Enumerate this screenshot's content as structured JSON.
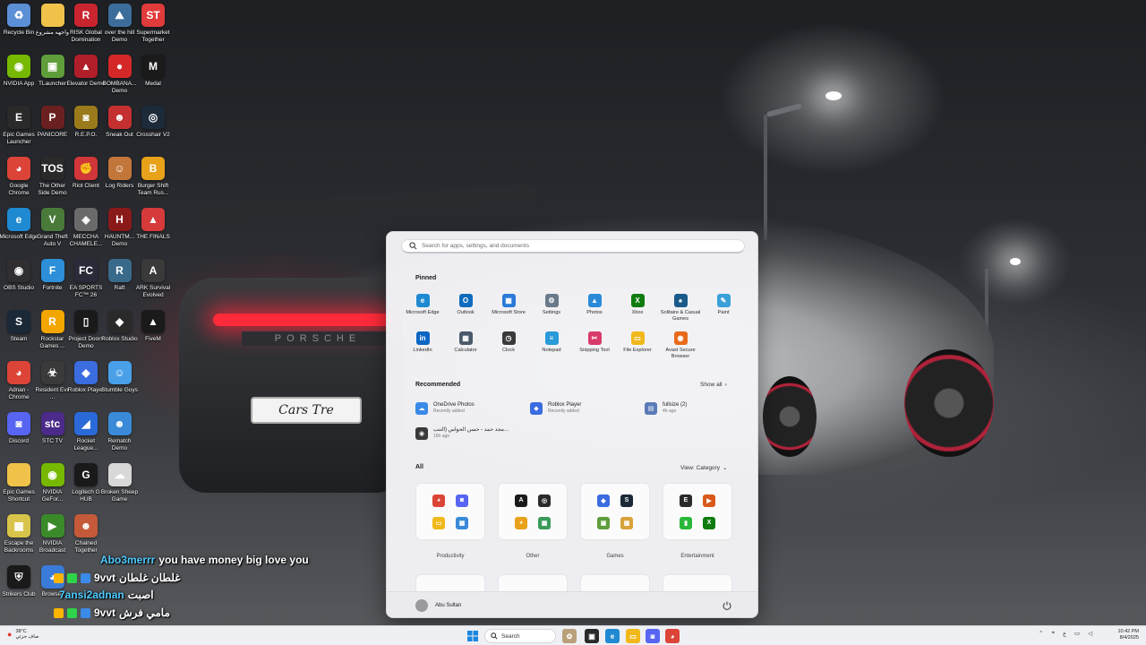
{
  "desktop": {
    "icons": [
      {
        "label": "Recycle Bin",
        "icon": "recycle-bin-icon",
        "color": "#5b8fd6",
        "glyph": "♻"
      },
      {
        "label": "واجهه مشروع",
        "icon": "folder-icon",
        "color": "#f0c24a",
        "glyph": ""
      },
      {
        "label": "RISK Global Domination",
        "icon": "risk-icon",
        "color": "#c9252f",
        "glyph": "R"
      },
      {
        "label": "over the hill Demo",
        "icon": "over-the-hill-icon",
        "color": "#3c6d9a",
        "glyph": "⛰"
      },
      {
        "label": "Supermarket Together",
        "icon": "supermarket-icon",
        "color": "#e03b3b",
        "glyph": "ST"
      },
      {
        "label": "NVIDIA App",
        "icon": "nvidia-icon",
        "color": "#76b900",
        "glyph": "◉"
      },
      {
        "label": "TLauncher",
        "icon": "tlauncher-icon",
        "color": "#5f9e3a",
        "glyph": "▣"
      },
      {
        "label": "Elevator Demo",
        "icon": "elevator-icon",
        "color": "#b01e2a",
        "glyph": "▲"
      },
      {
        "label": "BOMBANA... Demo",
        "icon": "bombana-icon",
        "color": "#d42828",
        "glyph": "●"
      },
      {
        "label": "Medal",
        "icon": "medal-icon",
        "color": "#1a1a1a",
        "glyph": "M"
      },
      {
        "label": "Epic Games Launcher",
        "icon": "epic-games-icon",
        "color": "#2a2a2a",
        "glyph": "E"
      },
      {
        "label": "PANICORE",
        "icon": "panicore-icon",
        "color": "#6b2020",
        "glyph": "P"
      },
      {
        "label": "R.E.P.O.",
        "icon": "repo-icon",
        "color": "#9a7a1a",
        "glyph": "◙"
      },
      {
        "label": "Sneak Out",
        "icon": "sneak-out-icon",
        "color": "#c43030",
        "glyph": "☻"
      },
      {
        "label": "Crosshair V2",
        "icon": "crosshair-icon",
        "color": "#1c2a3a",
        "glyph": "◎"
      },
      {
        "label": "Google Chrome",
        "icon": "chrome-icon",
        "color": "#db4437",
        "glyph": "◕"
      },
      {
        "label": "The Other Side Demo",
        "icon": "other-side-icon",
        "color": "#2a2a2a",
        "glyph": "TOS"
      },
      {
        "label": "Riot Client",
        "icon": "riot-icon",
        "color": "#d13639",
        "glyph": "✊"
      },
      {
        "label": "Log Riders",
        "icon": "log-riders-icon",
        "color": "#c2763a",
        "glyph": "☺"
      },
      {
        "label": "Burger Shift Team Rus...",
        "icon": "burger-shift-icon",
        "color": "#e8a21a",
        "glyph": "B"
      },
      {
        "label": "Microsoft Edge",
        "icon": "edge-icon",
        "color": "#1f8ad2",
        "glyph": "e"
      },
      {
        "label": "Grand Theft Auto V",
        "icon": "gta-icon",
        "color": "#4a7a3a",
        "glyph": "V"
      },
      {
        "label": "MECCHA CHAMELE...",
        "icon": "meccha-icon",
        "color": "#6a6a6a",
        "glyph": "◈"
      },
      {
        "label": "HAUNTM... Demo",
        "icon": "hauntm-icon",
        "color": "#8a1a1a",
        "glyph": "H"
      },
      {
        "label": "THE FINALS",
        "icon": "the-finals-icon",
        "color": "#d63a3a",
        "glyph": "▲"
      },
      {
        "label": "OBS Studio",
        "icon": "obs-icon",
        "color": "#302e31",
        "glyph": "◉"
      },
      {
        "label": "Fortnite",
        "icon": "fortnite-icon",
        "color": "#2c8fd8",
        "glyph": "F"
      },
      {
        "label": "EA SPORTS FC™ 26",
        "icon": "ea-fc-icon",
        "color": "#2a2a3a",
        "glyph": "FC"
      },
      {
        "label": "Raft",
        "icon": "raft-icon",
        "color": "#3a6a8a",
        "glyph": "R"
      },
      {
        "label": "ARK Survival Evolved",
        "icon": "ark-icon",
        "color": "#3a3a3a",
        "glyph": "A"
      },
      {
        "label": "Steam",
        "icon": "steam-icon",
        "color": "#1b2838",
        "glyph": "S"
      },
      {
        "label": "Rockstar Games ...",
        "icon": "rockstar-icon",
        "color": "#f3a600",
        "glyph": "R"
      },
      {
        "label": "Project Doors Demo",
        "icon": "project-doors-icon",
        "color": "#1a1a1a",
        "glyph": "▯"
      },
      {
        "label": "Roblox Studio",
        "icon": "roblox-studio-icon",
        "color": "#2a2a2a",
        "glyph": "◆"
      },
      {
        "label": "FiveM",
        "icon": "fivem-icon",
        "color": "#1a1a1a",
        "glyph": "▲"
      },
      {
        "label": "Adnan - Chrome",
        "icon": "chrome-profile-icon",
        "color": "#db4437",
        "glyph": "◕"
      },
      {
        "label": "Resident Evil ...",
        "icon": "resident-evil-icon",
        "color": "#3a3a3a",
        "glyph": "☣"
      },
      {
        "label": "Roblox Player",
        "icon": "roblox-player-icon",
        "color": "#3b6ce0",
        "glyph": "◆"
      },
      {
        "label": "Stumble Guys",
        "icon": "stumble-guys-icon",
        "color": "#4aa0e8",
        "glyph": "☺"
      },
      {
        "label": "",
        "icon": "blank-icon",
        "color": "transparent",
        "glyph": ""
      },
      {
        "label": "Discord",
        "icon": "discord-icon",
        "color": "#5865f2",
        "glyph": "◙"
      },
      {
        "label": "STC TV",
        "icon": "stc-tv-icon",
        "color": "#4b2a8a",
        "glyph": "stc"
      },
      {
        "label": "Rocket League...",
        "icon": "rocket-league-icon",
        "color": "#2a6ad8",
        "glyph": "◢"
      },
      {
        "label": "Rematch Demo",
        "icon": "rematch-icon",
        "color": "#3a8ad8",
        "glyph": "☻"
      },
      {
        "label": "",
        "icon": "blank-icon",
        "color": "transparent",
        "glyph": ""
      },
      {
        "label": "Epic Games Shortcut",
        "icon": "epic-shortcut-icon",
        "color": "#f0c24a",
        "glyph": ""
      },
      {
        "label": "NVIDIA GeFor...",
        "icon": "geforce-icon",
        "color": "#76b900",
        "glyph": "◉"
      },
      {
        "label": "Logitech G HUB",
        "icon": "ghub-icon",
        "color": "#1a1a1a",
        "glyph": "G"
      },
      {
        "label": "Broken Sheep Game",
        "icon": "sheep-game-icon",
        "color": "#d8d8d8",
        "glyph": "☁"
      },
      {
        "label": "",
        "icon": "blank-icon",
        "color": "transparent",
        "glyph": ""
      },
      {
        "label": "Escape the Backrooms",
        "icon": "backrooms-icon",
        "color": "#d8c44a",
        "glyph": "▦"
      },
      {
        "label": "NVIDIA Broadcast",
        "icon": "nvidia-broadcast-icon",
        "color": "#3a8a2a",
        "glyph": "▶"
      },
      {
        "label": "Chained Together",
        "icon": "chained-together-icon",
        "color": "#c45a3a",
        "glyph": "☻"
      },
      {
        "label": "",
        "icon": "blank-icon",
        "color": "transparent",
        "glyph": ""
      },
      {
        "label": "",
        "icon": "blank-icon",
        "color": "transparent",
        "glyph": ""
      },
      {
        "label": "Strikers Club",
        "icon": "strikers-club-icon",
        "color": "#1a1a1a",
        "glyph": "⛨"
      },
      {
        "label": "Browser",
        "icon": "browser-icon",
        "color": "#3a7ad8",
        "glyph": "◕"
      }
    ]
  },
  "start_menu": {
    "search_placeholder": "Search for apps, settings, and documents",
    "pinned_title": "Pinned",
    "pinned": [
      {
        "label": "Microsoft Edge",
        "icon": "edge-icon",
        "color": "#1f8ad2",
        "glyph": "e"
      },
      {
        "label": "Outlook",
        "icon": "outlook-icon",
        "color": "#0f6cbd",
        "glyph": "O"
      },
      {
        "label": "Microsoft Store",
        "icon": "store-icon",
        "color": "#2a7ad8",
        "glyph": "▦"
      },
      {
        "label": "Settings",
        "icon": "settings-icon",
        "color": "#6a7a8a",
        "glyph": "⚙"
      },
      {
        "label": "Photos",
        "icon": "photos-icon",
        "color": "#2a8ad8",
        "glyph": "▲"
      },
      {
        "label": "Xbox",
        "icon": "xbox-icon",
        "color": "#107c10",
        "glyph": "X"
      },
      {
        "label": "Solitaire & Casual Games",
        "icon": "solitaire-icon",
        "color": "#1a5a8a",
        "glyph": "♠"
      },
      {
        "label": "Paint",
        "icon": "paint-icon",
        "color": "#3aa0d8",
        "glyph": "✎"
      },
      {
        "label": "LinkedIn",
        "icon": "linkedin-icon",
        "color": "#0a66c2",
        "glyph": "in"
      },
      {
        "label": "Calculator",
        "icon": "calculator-icon",
        "color": "#4a5a6a",
        "glyph": "▦"
      },
      {
        "label": "Clock",
        "icon": "clock-icon",
        "color": "#3a3a3a",
        "glyph": "◷"
      },
      {
        "label": "Notepad",
        "icon": "notepad-icon",
        "color": "#2a9ad8",
        "glyph": "≡"
      },
      {
        "label": "Snipping Tool",
        "icon": "snipping-tool-icon",
        "color": "#d83a6a",
        "glyph": "✂"
      },
      {
        "label": "File Explorer",
        "icon": "file-explorer-icon",
        "color": "#f0b81a",
        "glyph": "▭"
      },
      {
        "label": "Avast Secure Browser",
        "icon": "avast-browser-icon",
        "color": "#e86a1a",
        "glyph": "◉"
      }
    ],
    "recommended_title": "Recommended",
    "show_all": "Show all",
    "recommended": [
      {
        "title": "OneDrive Photos",
        "sub": "Recently added",
        "icon": "onedrive-icon",
        "color": "#3a8ae8",
        "glyph": "☁"
      },
      {
        "title": "Roblox Player",
        "sub": "Recently added",
        "icon": "roblox-player-icon",
        "color": "#3b6ce0",
        "glyph": "◆"
      },
      {
        "title": "fullsize (2)",
        "sub": "4h ago",
        "icon": "file-icon",
        "color": "#5a7ab8",
        "glyph": "▤"
      },
      {
        "title": "مجد حمد - حسن الحواس (التنب...",
        "sub": "16h ago",
        "icon": "media-file-icon",
        "color": "#3a3a3a",
        "glyph": "◉"
      }
    ],
    "all_title": "All",
    "view_label": "View: Category",
    "categories": [
      {
        "name": "Productivity",
        "apps": [
          {
            "icon": "chrome-icon",
            "color": "#db4437",
            "glyph": "◕"
          },
          {
            "icon": "discord-icon",
            "color": "#5865f2",
            "glyph": "◙"
          },
          {
            "icon": "folder-icon",
            "color": "#f0b81a",
            "glyph": "▭"
          },
          {
            "icon": "control-panel-icon",
            "color": "#3a8ad8",
            "glyph": "▦"
          }
        ]
      },
      {
        "name": "Other",
        "apps": [
          {
            "icon": "ark-icon",
            "color": "#1a1a1a",
            "glyph": "A"
          },
          {
            "icon": "crosshair-icon",
            "color": "#2a2a2a",
            "glyph": "◎"
          },
          {
            "icon": "chrome-canary-icon",
            "color": "#e8a21a",
            "glyph": "◕"
          },
          {
            "icon": "apps-icon",
            "color": "#3a9a5a",
            "glyph": "▦"
          }
        ]
      },
      {
        "name": "Games",
        "apps": [
          {
            "icon": "roblox-player-icon",
            "color": "#3b6ce0",
            "glyph": "◆"
          },
          {
            "icon": "steam-icon",
            "color": "#1b2838",
            "glyph": "S"
          },
          {
            "icon": "minecraft-icon",
            "color": "#5f9e3a",
            "glyph": "▣"
          },
          {
            "icon": "games-folder-icon",
            "color": "#d8a23a",
            "glyph": "▦"
          }
        ]
      },
      {
        "name": "Entertainment",
        "apps": [
          {
            "icon": "epic-games-icon",
            "color": "#2a2a2a",
            "glyph": "E"
          },
          {
            "icon": "media-player-icon",
            "color": "#d85a1a",
            "glyph": "▶"
          },
          {
            "icon": "game-pass-icon",
            "color": "#2ab83a",
            "glyph": "▮"
          },
          {
            "icon": "xbox-icon",
            "color": "#107c10",
            "glyph": "X"
          }
        ]
      }
    ],
    "user_name": "Abu Sultan"
  },
  "chat": [
    {
      "user": "Abo3merrr",
      "msg": "you have money big love you",
      "badge": ""
    },
    {
      "user": "",
      "msg": "غلطان غلطان",
      "badge": "9vvt"
    },
    {
      "user": "7ansi2adnan",
      "msg": "اصبت",
      "badge": ""
    },
    {
      "user": "",
      "msg": "مامي فرش",
      "badge": "9vvt"
    },
    {
      "user": "",
      "msg": "????",
      "badge": "9vvt"
    }
  ],
  "taskbar": {
    "weather_temp": "38°C",
    "weather_desc": "صاف جزئي",
    "search_label": "Search",
    "tray_lang": "ع",
    "time": "10:42 PM",
    "date": "8/4/2025"
  }
}
